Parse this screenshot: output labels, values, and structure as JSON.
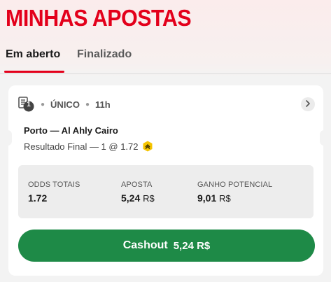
{
  "page": {
    "title": "MINHAS APOSTAS"
  },
  "tabs": [
    {
      "label": "Em aberto",
      "active": true
    },
    {
      "label": "Finalizado",
      "active": false
    }
  ],
  "bet": {
    "count_badge": "1",
    "type": "ÚNICO",
    "time": "11h",
    "match": "Porto — Al Ahly Cairo",
    "selection": "Resultado Final — 1 @ 1.72",
    "icons": {
      "bet_slip": "bet-slip-icon",
      "badge": "boost-badge-icon",
      "chevron": "chevron-right-icon"
    },
    "stats": {
      "odds_label": "ODDS TOTAIS",
      "odds_value": "1.72",
      "stake_label": "APOSTA",
      "stake_value": "5,24",
      "stake_currency": "R$",
      "payout_label": "GANHO POTENCIAL",
      "payout_value": "9,01",
      "payout_currency": "R$"
    },
    "cashout": {
      "label": "Cashout",
      "amount": "5,24 R$"
    }
  },
  "colors": {
    "brand_red": "#e3001b",
    "cashout_green": "#1e8a47",
    "badge_yellow": "#f5c400"
  }
}
